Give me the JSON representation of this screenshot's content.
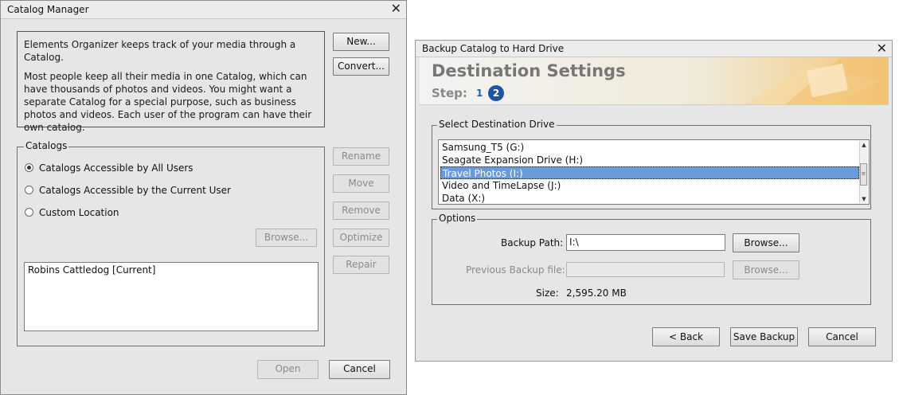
{
  "catalog_manager": {
    "title": "Catalog Manager",
    "intro_p1": "Elements Organizer keeps track of your media through a Catalog.",
    "intro_p2": "Most people keep all their media in one Catalog, which can have thousands of photos and videos. You might want a separate Catalog for a special purpose, such as business photos and videos. Each user of the program can have their own catalog.",
    "new_label": "New...",
    "convert_label": "Convert...",
    "catalogs_legend": "Catalogs",
    "radio_all": "Catalogs Accessible by All Users",
    "radio_current": "Catalogs Accessible by the Current User",
    "radio_custom": "Custom Location",
    "browse_label": "Browse...",
    "rename_label": "Rename",
    "move_label": "Move",
    "remove_label": "Remove",
    "optimize_label": "Optimize",
    "repair_label": "Repair",
    "catalog_list": [
      "Robins Cattledog [Current]"
    ],
    "open_label": "Open",
    "cancel_label": "Cancel"
  },
  "backup": {
    "title": "Backup Catalog to Hard Drive",
    "heading": "Destination Settings",
    "step_label": "Step:",
    "step1": "1",
    "step2": "2",
    "drive_legend": "Select Destination Drive",
    "drives": [
      "Samsung_T5 (G:)",
      "Seagate Expansion Drive (H:)",
      "Travel Photos (I:)",
      "Video and TimeLapse (J:)",
      "Data (X:)"
    ],
    "options_legend": "Options",
    "backup_path_label": "Backup Path:",
    "backup_path_value": "I:\\",
    "browse_label": "Browse...",
    "prev_file_label": "Previous Backup file:",
    "prev_file_value": "",
    "browse2_label": "Browse...",
    "size_label": "Size:",
    "size_value": "2,595.20 MB",
    "back_label": "< Back",
    "save_label": "Save Backup",
    "cancel_label": "Cancel"
  }
}
